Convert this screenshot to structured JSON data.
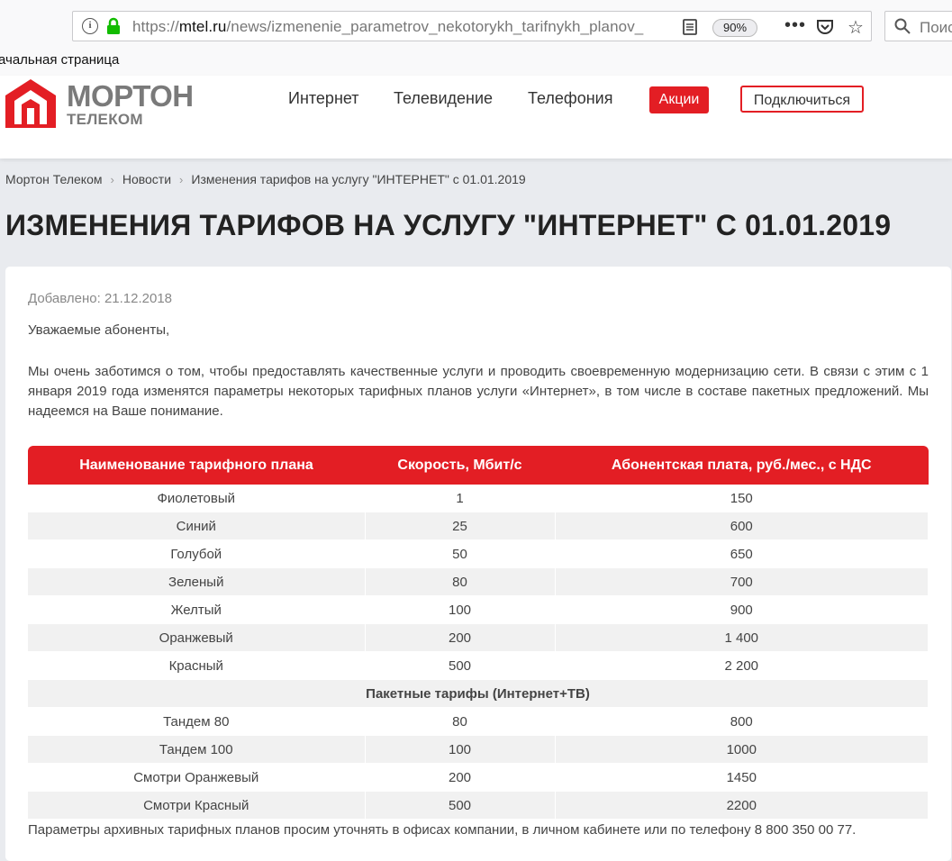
{
  "browser": {
    "url_scheme": "https://",
    "url_domain": "mtel.ru",
    "url_path": "/news/izmenenie_parametrov_nekotorykh_tarifnykh_planov_",
    "zoom": "90%",
    "search_placeholder": "Поиск",
    "bookmark_label": "ачальная страница"
  },
  "header": {
    "logo_title": "МОРТОН",
    "logo_subtitle": "ТЕЛЕКОМ",
    "nav": [
      "Интернет",
      "Телевидение",
      "Телефония"
    ],
    "promo_label": "Акции",
    "connect_label": "Подключиться"
  },
  "colors": {
    "accent": "#e31e24"
  },
  "breadcrumbs": [
    "Мортон Телеком",
    "Новости",
    "Изменения тарифов на услугу \"ИНТЕРНЕТ\" с 01.01.2019"
  ],
  "page_title": "ИЗМЕНЕНИЯ ТАРИФОВ НА УСЛУГУ \"ИНТЕРНЕТ\" С 01.01.2019",
  "article": {
    "date": "Добавлено: 21.12.2018",
    "greeting": "Уважаемые абоненты,",
    "body": "Мы очень заботимся о том, чтобы предоставлять качественные услуги и проводить своевременную модернизацию сети. В связи с этим с 1 января 2019 года изменятся параметры некоторых тарифных планов услуги «Интернет», в том числе в составе пакетных предложений. Мы надеемся на Ваше понимание.",
    "footnote": "Параметры архивных тарифных планов просим уточнять в офисах компании, в личном кабинете или по телефону 8 800 350 00 77."
  },
  "table": {
    "headers": [
      "Наименование тарифного плана",
      "Скорость, Мбит/с",
      "Абонентская плата, руб./мес., с НДС"
    ],
    "rows": [
      [
        "Фиолетовый",
        "1",
        "150"
      ],
      [
        "Синий",
        "25",
        "600"
      ],
      [
        "Голубой",
        "50",
        "650"
      ],
      [
        "Зеленый",
        "80",
        "700"
      ],
      [
        "Желтый",
        "100",
        "900"
      ],
      [
        "Оранжевый",
        "200",
        "1 400"
      ],
      [
        "Красный",
        "500",
        "2 200"
      ]
    ],
    "group_title": "Пакетные тарифы (Интернет+ТВ)",
    "group_rows": [
      [
        "Тандем 80",
        "80",
        "800"
      ],
      [
        "Тандем 100",
        "100",
        "1000"
      ],
      [
        "Смотри Оранжевый",
        "200",
        "1450"
      ],
      [
        "Смотри Красный",
        "500",
        "2200"
      ]
    ]
  }
}
